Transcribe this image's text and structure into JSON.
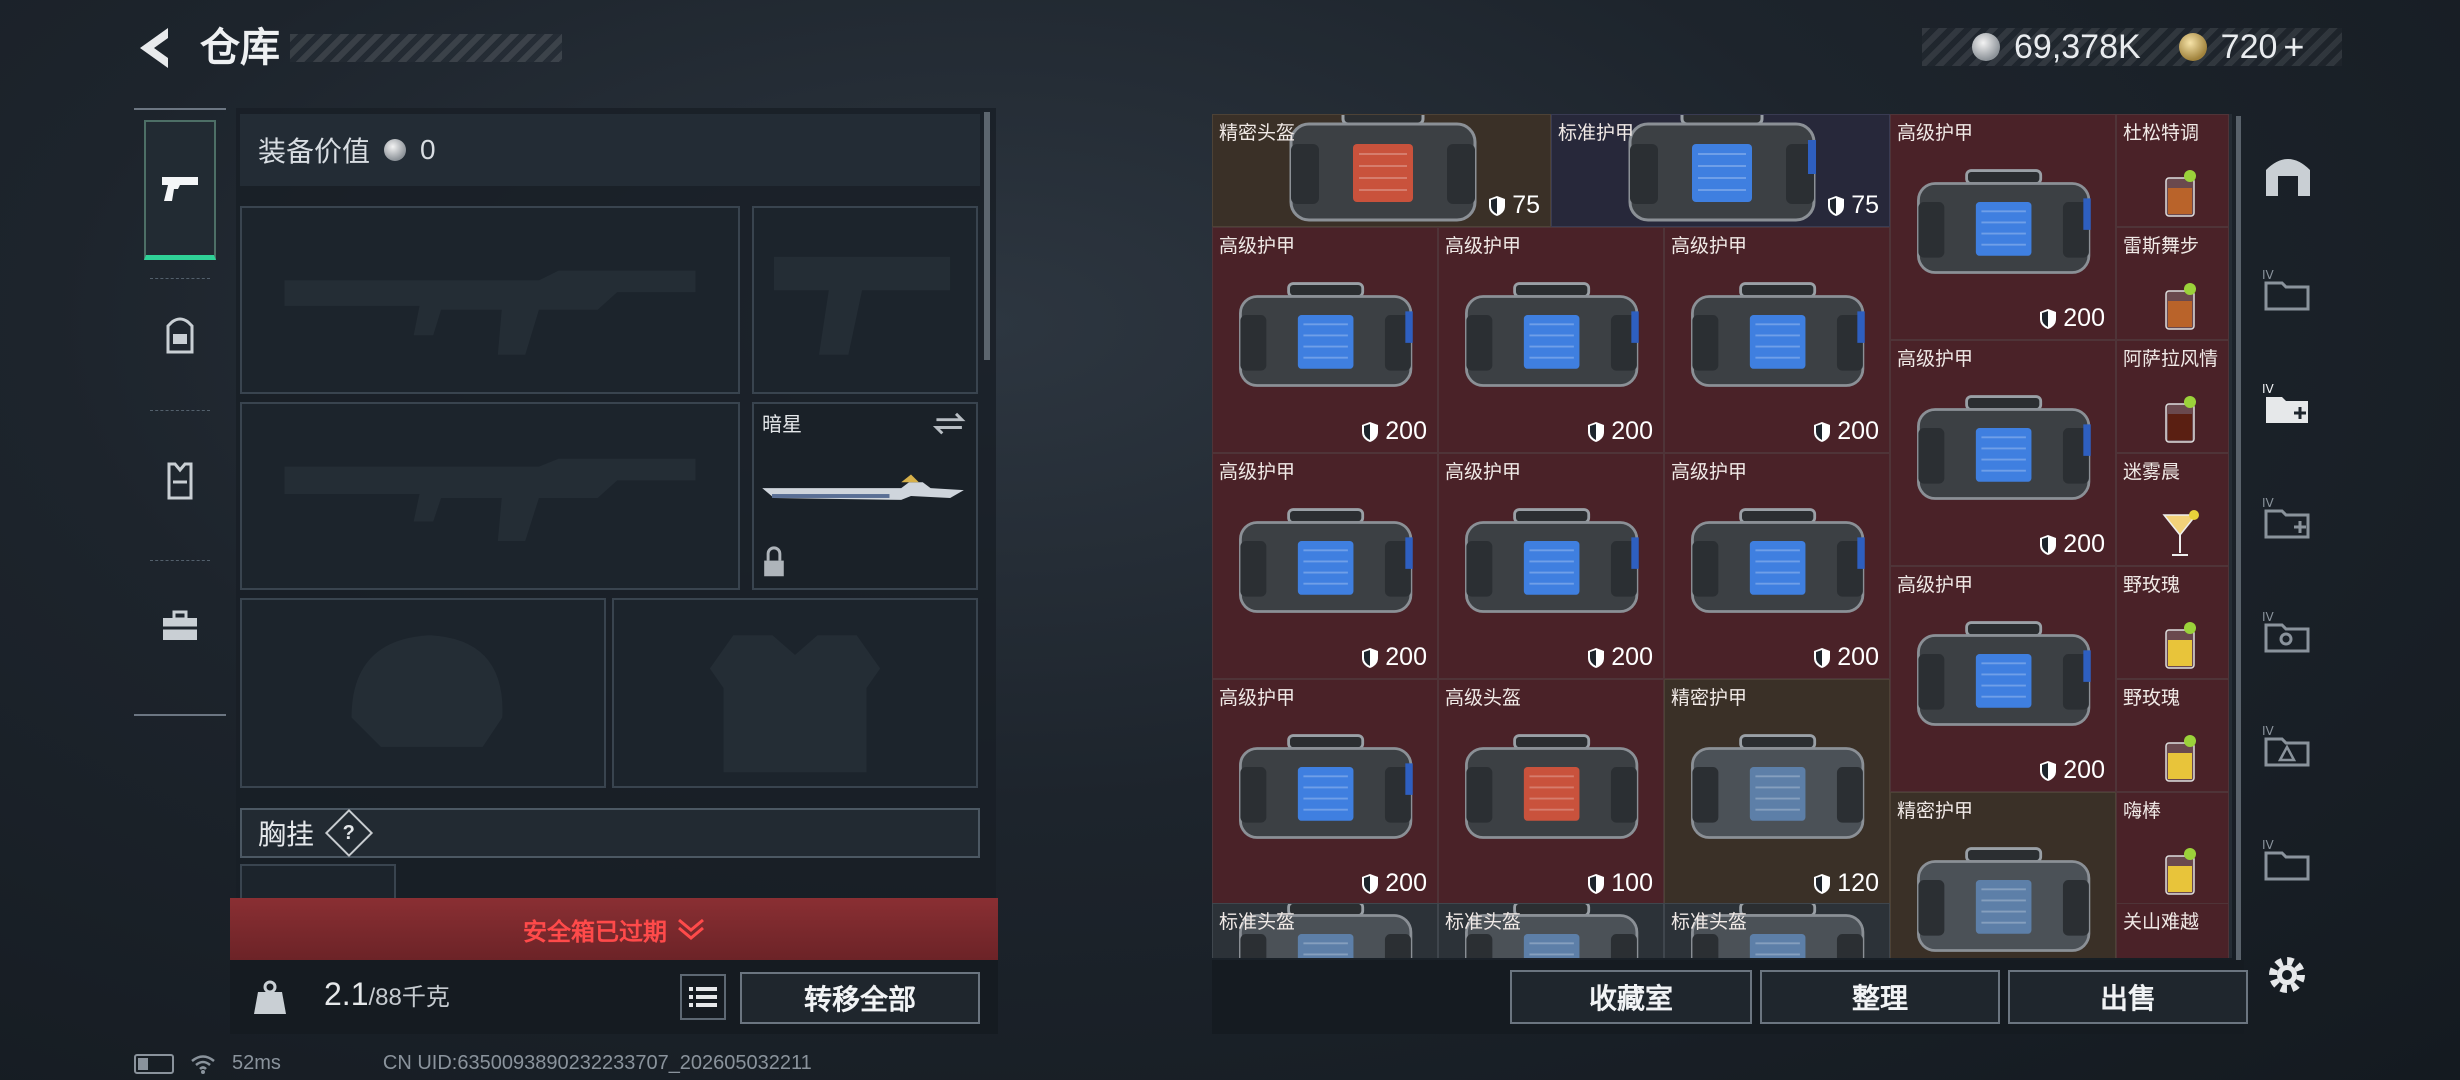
{
  "header": {
    "title": "仓库",
    "currency_silver": "69,378K",
    "currency_gold": "720",
    "currency_gold_suffix": "+"
  },
  "sidebar": {
    "tabs": [
      {
        "icon": "pistol-icon",
        "active": true
      },
      {
        "icon": "backpack-icon",
        "active": false
      },
      {
        "icon": "vest-icon",
        "active": false
      },
      {
        "icon": "toolbox-icon",
        "active": false
      }
    ]
  },
  "equipment": {
    "value_label": "装备价值",
    "value": "0",
    "melee_name": "暗星",
    "chest_label": "胸挂",
    "help_label": "?",
    "safebox_text": "安全箱已过期",
    "weight": "2.1",
    "weight_max": "/88千克",
    "transfer_all": "转移全部"
  },
  "inventory": {
    "items": [
      {
        "name": "精密头盔",
        "value": "75"
      },
      {
        "name": "标准护甲",
        "value": "75"
      },
      {
        "name": "高级护甲",
        "value": "200"
      },
      {
        "name": "杜松特调",
        "value": ""
      },
      {
        "name": "高级护甲",
        "value": "200"
      },
      {
        "name": "高级护甲",
        "value": "200"
      },
      {
        "name": "高级护甲",
        "value": "200"
      },
      {
        "name": "雷斯舞步",
        "value": ""
      },
      {
        "name": "高级护甲",
        "value": "200"
      },
      {
        "name": "阿萨拉风情",
        "value": ""
      },
      {
        "name": "高级护甲",
        "value": "200"
      },
      {
        "name": "高级护甲",
        "value": "200"
      },
      {
        "name": "高级护甲",
        "value": "200"
      },
      {
        "name": "迷雾晨",
        "value": ""
      },
      {
        "name": "高级护甲",
        "value": "200"
      },
      {
        "name": "野玫瑰",
        "value": ""
      },
      {
        "name": "高级护甲",
        "value": "200"
      },
      {
        "name": "高级头盔",
        "value": "100"
      },
      {
        "name": "精密护甲",
        "value": "120"
      },
      {
        "name": "野玫瑰",
        "value": ""
      },
      {
        "name": "精密护甲",
        "value": ""
      },
      {
        "name": "嗨棒",
        "value": ""
      },
      {
        "name": "标准头盔",
        "value": ""
      },
      {
        "name": "标准头盔",
        "value": ""
      },
      {
        "name": "标准头盔",
        "value": ""
      },
      {
        "name": "关山难越",
        "value": ""
      }
    ]
  },
  "actions": {
    "collection": "收藏室",
    "sort": "整理",
    "sell": "出售"
  },
  "status": {
    "ping": "52ms",
    "uid": "CN UID:6350093890232233707_202605032211"
  },
  "colors": {
    "accent_green": "#2fd197",
    "warning_red": "#ff4a4a",
    "armor_cell": "#4a2228"
  }
}
